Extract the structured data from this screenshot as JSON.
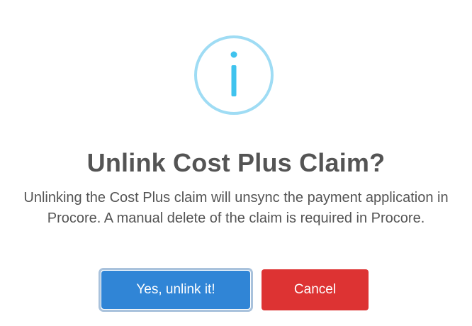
{
  "dialog": {
    "icon": "info-icon",
    "title": "Unlink Cost Plus Claim?",
    "message": "Unlinking the Cost Plus claim will unsync the payment application in Procore. A manual delete of the claim is required in Procore.",
    "confirm_label": "Yes, unlink it!",
    "cancel_label": "Cancel"
  },
  "colors": {
    "icon_ring": "#9fdcf4",
    "icon_glyph": "#3fc3ee",
    "confirm": "#3085d6",
    "cancel": "#dd3333",
    "text": "#545454"
  }
}
